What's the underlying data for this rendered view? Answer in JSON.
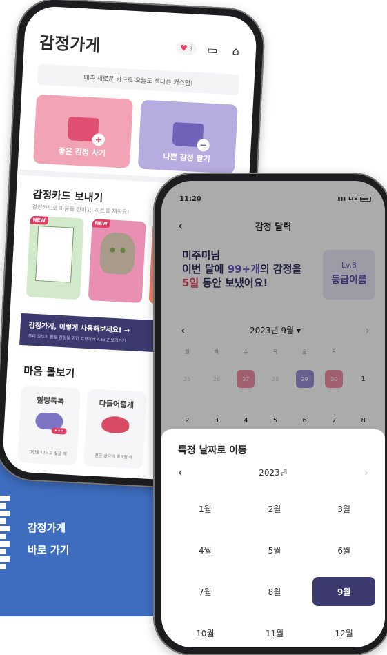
{
  "promo": {
    "title": "감정가게",
    "subtitle": "바로 가기"
  },
  "home": {
    "app_title": "감정가게",
    "heart_count": "3",
    "banner_text": "매주 새로운 카드로 오늘도 색다른 커스텀!",
    "actions": [
      {
        "label": "좋은 감정 사기",
        "badge": "+"
      },
      {
        "label": "나쁜 감정 팔기",
        "badge": "−"
      }
    ],
    "send_section": {
      "title": "감정카드 보내기",
      "subtitle": "감정카드로 마음을 전하고, 하트를 채워요!",
      "new_badge": "NEW"
    },
    "guide": {
      "title": "감정가게, 이렇게 사용해보세요! →",
      "subtitle": "우리 모두의 좋은 감정을 위한 감정가게 A to Z 보러가기"
    },
    "care_section": {
      "title": "마음 돌보기",
      "cards": [
        {
          "title": "힐링톡톡",
          "desc": "고민을 나누고 싶을 때"
        },
        {
          "title": "다들어줄개",
          "desc": "전문 상담이 필요할 때"
        }
      ]
    }
  },
  "calendar": {
    "status_time": "11:20",
    "status_network": "LTE",
    "nav_title": "감정 달력",
    "stats": {
      "line1": "미주미님",
      "line2_prefix": "이번 달에 ",
      "line2_count": "99+개",
      "line2_suffix": "의 감정을",
      "line3_days": "5일",
      "line3_suffix": " 동안 보냈어요!"
    },
    "level": {
      "num": "Lv.3",
      "name": "등급이름"
    },
    "month_label": "2023년 9월 ▾",
    "weekdays": [
      "월",
      "화",
      "수",
      "목",
      "금",
      "토"
    ],
    "row1": [
      "25",
      "26",
      "27",
      "28",
      "29",
      "30",
      "1"
    ],
    "row2": [
      "2",
      "3",
      "4",
      "5",
      "6",
      "7",
      "8"
    ]
  },
  "sheet": {
    "title": "특정 날짜로 이동",
    "year_label": "2023년",
    "months": [
      "1월",
      "2월",
      "3월",
      "4월",
      "5월",
      "6월",
      "7월",
      "8월",
      "9월",
      "10월",
      "11월",
      "12월"
    ],
    "selected_month": "9월"
  },
  "colors": {
    "accent": "#3c3a6e",
    "pink": "#f2a3b5",
    "purple": "#b7ace0",
    "promo_blue": "#3e6dbf"
  }
}
